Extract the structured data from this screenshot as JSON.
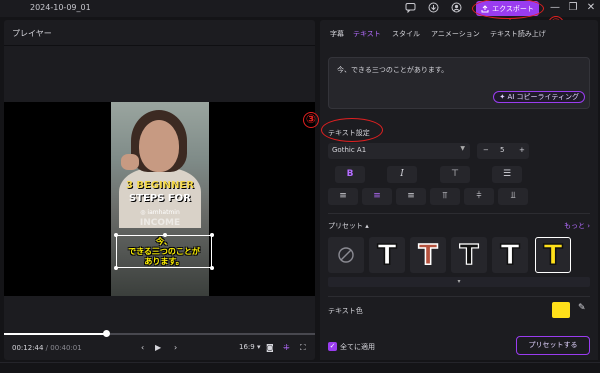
{
  "titlebar": {
    "project_title": "2024-10-09_01",
    "export_label": "エクスポート",
    "icons": [
      "message-icon",
      "download-icon",
      "account-icon"
    ]
  },
  "annotations": {
    "marker_3": "③",
    "marker_4": "④"
  },
  "player": {
    "header": "プレイヤー",
    "video_title_line1": "3 BEGINNER",
    "video_title_line2": "STEPS FOR",
    "video_handle": "iamhatmin",
    "video_title_line3": "INCOME",
    "subtitle_line1": "今、",
    "subtitle_line2": "できる三つのことが",
    "subtitle_line3": "あります。",
    "current_time": "00:12:44",
    "separator": " / ",
    "total_time": "00:40:01",
    "progress": 0.33,
    "aspect_ratio": "16:9"
  },
  "right_panel": {
    "tabs": [
      {
        "label": "字幕",
        "active": false
      },
      {
        "label": "テキスト",
        "active": true
      },
      {
        "label": "スタイル",
        "active": false
      },
      {
        "label": "アニメーション",
        "active": false
      },
      {
        "label": "テキスト読み上げ",
        "active": false
      }
    ],
    "text_value": "今、できる三つのことがあります。",
    "ai_button": "AI コピーライティング",
    "text_settings_label": "テキスト設定",
    "font_name": "Gothic A1",
    "font_size": "5",
    "preset_label": "プリセット",
    "more_label": "もっと",
    "text_color_label": "テキスト色",
    "text_color": "#ffe01a",
    "apply_all_label": "全てに適用",
    "preset_button": "プリセットする"
  },
  "presets": [
    {
      "name": "none"
    },
    {
      "fill": "#ffffff",
      "stroke": "#111111"
    },
    {
      "fill": "#b5523e",
      "stroke": "#ffffff"
    },
    {
      "fill": "#111111",
      "stroke": "#ffffff"
    },
    {
      "fill": "#ffffff",
      "stroke": "#111111"
    },
    {
      "fill": "#ffe01a",
      "stroke": "#111111",
      "selected": true
    }
  ],
  "colors": {
    "accent": "#9a3cf0",
    "annotation": "#e02020"
  }
}
